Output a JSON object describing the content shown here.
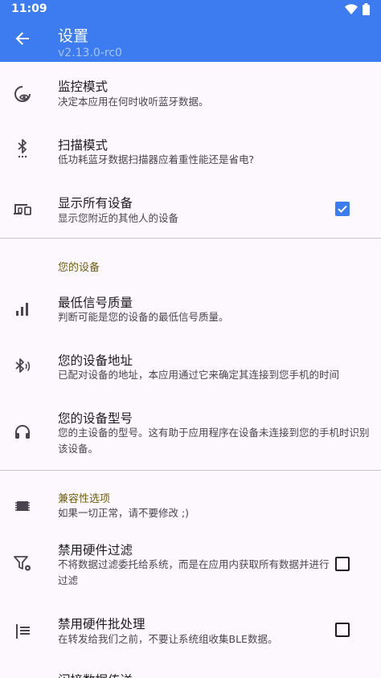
{
  "status": {
    "time": "11:09"
  },
  "header": {
    "title": "设置",
    "subtitle": "v2.13.0-rc0"
  },
  "items": {
    "monitor_mode": {
      "title": "监控模式",
      "summary": "决定本应用在何时收听蓝牙数据。"
    },
    "scan_mode": {
      "title": "扫描模式",
      "summary": "低功耗蓝牙数据扫描器应着重性能还是省电?"
    },
    "show_all_devices": {
      "title": "显示所有设备",
      "summary": "显示您附近的其他人的设备",
      "checked": true
    },
    "min_signal": {
      "title": "最低信号质量",
      "summary": "判断可能是您的设备的最低信号质量。"
    },
    "device_address": {
      "title": "您的设备地址",
      "summary": "已配对设备的地址，本应用通过它来确定其连接到您手机的时间"
    },
    "device_model": {
      "title": "您的设备型号",
      "summary": "您的主设备的型号。这有助于应用程序在设备未连接到您的手机时识别该设备。"
    },
    "compat_hint": {
      "summary": "如果一切正常，请不要修改 ;)"
    },
    "disable_hw_filter": {
      "title": "禁用硬件过滤",
      "summary": "不将数据过滤委托给系统，而是在应用内获取所有数据并进行过滤",
      "checked": false
    },
    "disable_hw_batch": {
      "title": "禁用硬件批处理",
      "summary": "在转发给我们之前，不要让系统组收集BLE数据。",
      "checked": false
    },
    "partial_next": {
      "title": "闪接数据传送"
    }
  },
  "sections": {
    "your_device": "您的设备",
    "compatibility": "兼容性选项"
  },
  "colors": {
    "appbar": "#3c7cf0",
    "accent": "#3c7cf0",
    "section_text": "#6d5e0f",
    "background": "#fdf8fd"
  },
  "icons": {
    "status": [
      "wifi-icon",
      "battery-icon"
    ],
    "back": "arrow-back-icon",
    "items": [
      "eye-monitor-icon",
      "bluetooth-scan-icon",
      "devices-icon",
      "signal-bars-icon",
      "bluetooth-audio-icon",
      "headphones-icon",
      "memory-chip-icon",
      "filter-settings-icon",
      "batch-list-icon"
    ]
  }
}
